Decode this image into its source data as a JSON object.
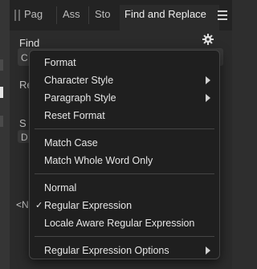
{
  "tabs": [
    {
      "label": "Pag"
    },
    {
      "label": "Ass"
    },
    {
      "label": "Sto"
    },
    {
      "label": "Find and Replace"
    }
  ],
  "find_label": "Find",
  "background_fragments": {
    "field_initial": "C",
    "re_label": "Re",
    "s_label": "S",
    "d_label": "D",
    "n_text": "<N"
  },
  "menu": {
    "groups": [
      [
        {
          "label": "Format",
          "submenu": false,
          "checked": false
        },
        {
          "label": "Character Style",
          "submenu": true,
          "checked": false
        },
        {
          "label": "Paragraph Style",
          "submenu": true,
          "checked": false
        },
        {
          "label": "Reset Format",
          "submenu": false,
          "checked": false
        }
      ],
      [
        {
          "label": "Match Case",
          "submenu": false,
          "checked": false
        },
        {
          "label": "Match Whole Word Only",
          "submenu": false,
          "checked": false
        }
      ],
      [
        {
          "label": "Normal",
          "submenu": false,
          "checked": false
        },
        {
          "label": "Regular Expression",
          "submenu": false,
          "checked": true
        },
        {
          "label": "Locale Aware Regular Expression",
          "submenu": false,
          "checked": false
        }
      ],
      [
        {
          "label": "Regular Expression Options",
          "submenu": true,
          "checked": false
        }
      ]
    ],
    "check_glyph": "✓"
  }
}
